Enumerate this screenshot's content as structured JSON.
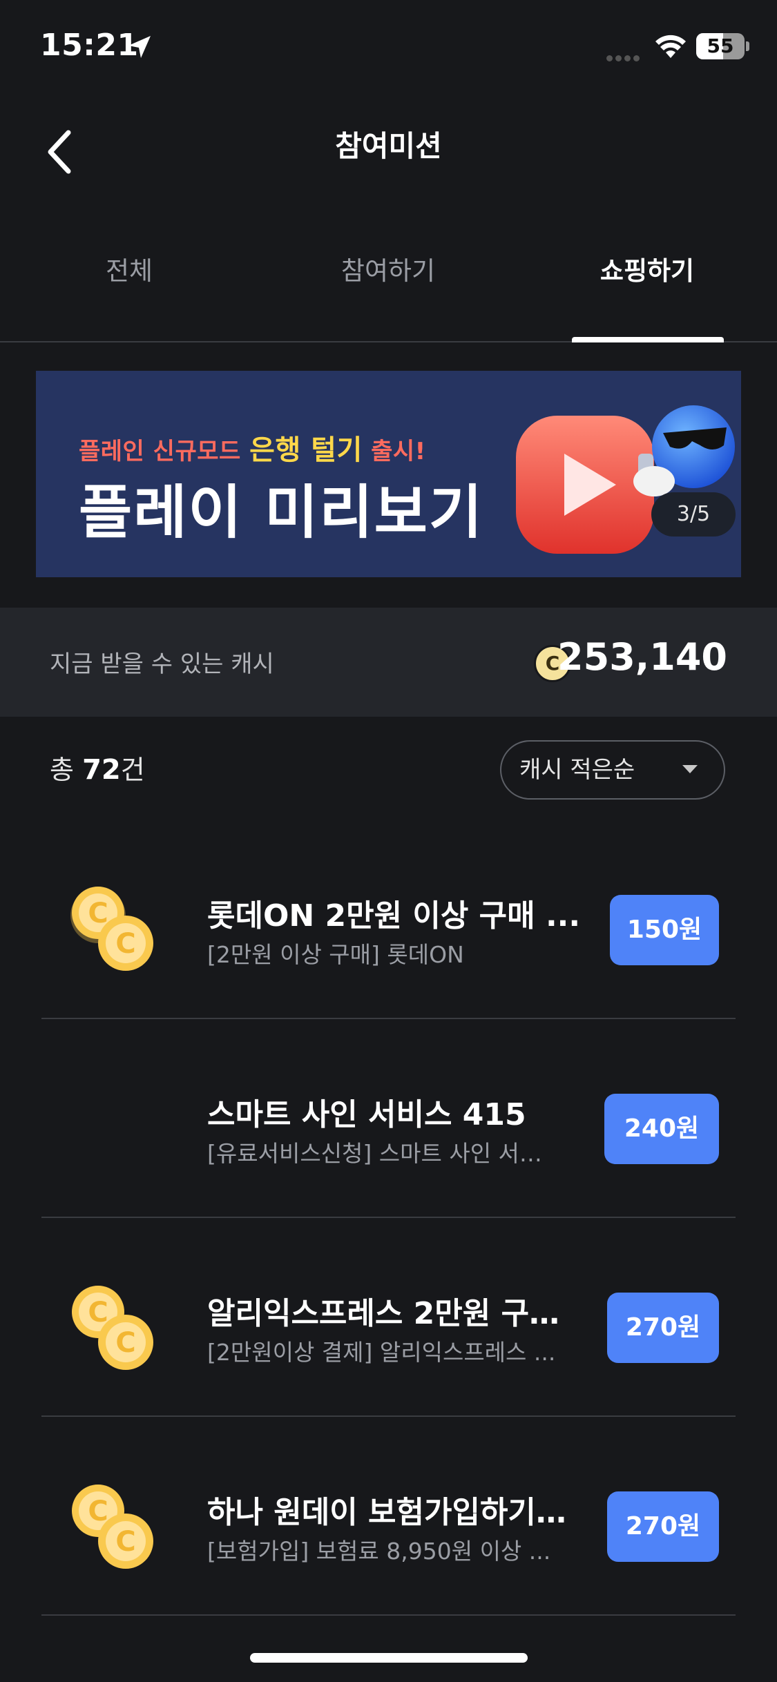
{
  "status_bar": {
    "time": "15:21",
    "battery_level": "55"
  },
  "header": {
    "title": "참여미션",
    "back_icon": "chevron-left-icon"
  },
  "tabs": [
    {
      "label": "전체",
      "active": false
    },
    {
      "label": "참여하기",
      "active": false
    },
    {
      "label": "쇼핑하기",
      "active": true
    }
  ],
  "banner": {
    "sub_prefix": "플레인 신규모드",
    "sub_highlight": "은행 털기",
    "sub_suffix": "출시!",
    "title": "플레이 미리보기",
    "page_indicator": "3/5"
  },
  "cash": {
    "label": "지금 받을 수 있는 캐시",
    "coin_symbol": "C",
    "amount": "253,140"
  },
  "list_header": {
    "count_prefix": "총",
    "count_value": "72",
    "count_suffix": "건",
    "sort_label": "캐시 적은순"
  },
  "missions": [
    {
      "title": "롯데ON 2만원 이상 구매 ...",
      "subtitle": "[2만원 이상 구매] 롯데ON",
      "reward": "150원",
      "has_coin_icon": true
    },
    {
      "title": "스마트 사인 서비스 415",
      "subtitle": "[유료서비스신청] 스마트 사인 서…",
      "reward": "240원",
      "has_coin_icon": false
    },
    {
      "title": "알리익스프레스 2만원 구…",
      "subtitle": "[2만원이상 결제] 알리익스프레스 ...",
      "reward": "270원",
      "has_coin_icon": true
    },
    {
      "title": "하나 원데이 보험가입하기…",
      "subtitle": "[보험가입] 보험료 8,950원 이상 ...",
      "reward": "270원",
      "has_coin_icon": true
    }
  ],
  "colors": {
    "background": "#17181b",
    "accent_blue": "#4f83f8",
    "banner_bg": "#263461",
    "coin_gold": "#f7c851"
  }
}
